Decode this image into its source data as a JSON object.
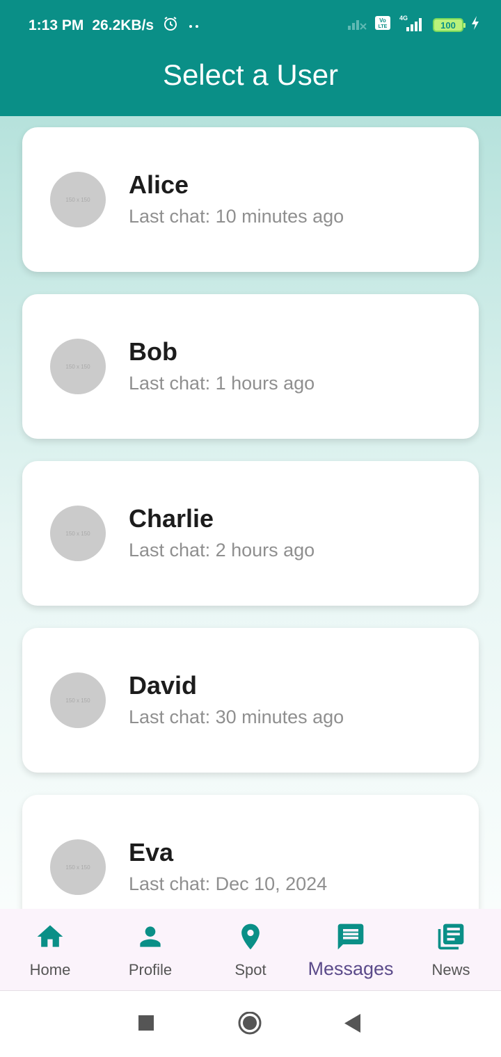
{
  "status_bar": {
    "time": "1:13 PM",
    "speed": "26.2KB/s",
    "battery": "100",
    "icons": [
      "alarm-icon",
      "dots-icon",
      "signal-x-icon",
      "volte-icon",
      "4g-signal-icon",
      "battery-icon",
      "charging-icon"
    ]
  },
  "app_bar": {
    "title": "Select a User"
  },
  "users": [
    {
      "name": "Alice",
      "last_chat": "Last chat: 10 minutes ago",
      "avatar_text": "150 x 150"
    },
    {
      "name": "Bob",
      "last_chat": "Last chat: 1 hours ago",
      "avatar_text": "150 x 150"
    },
    {
      "name": "Charlie",
      "last_chat": "Last chat: 2 hours ago",
      "avatar_text": "150 x 150"
    },
    {
      "name": "David",
      "last_chat": "Last chat: 30 minutes ago",
      "avatar_text": "150 x 150"
    },
    {
      "name": "Eva",
      "last_chat": "Last chat: Dec 10, 2024",
      "avatar_text": "150 x 150"
    }
  ],
  "bottom_nav": {
    "items": [
      {
        "label": "Home",
        "icon": "home-icon"
      },
      {
        "label": "Profile",
        "icon": "person-icon"
      },
      {
        "label": "Spot",
        "icon": "location-pin-icon"
      },
      {
        "label": "Messages",
        "icon": "chat-icon",
        "active": true
      },
      {
        "label": "News",
        "icon": "news-icon"
      }
    ]
  },
  "colors": {
    "primary": "#0a8f87",
    "nav_active_label": "#5b4a8a",
    "nav_background": "#fbf3fb"
  }
}
